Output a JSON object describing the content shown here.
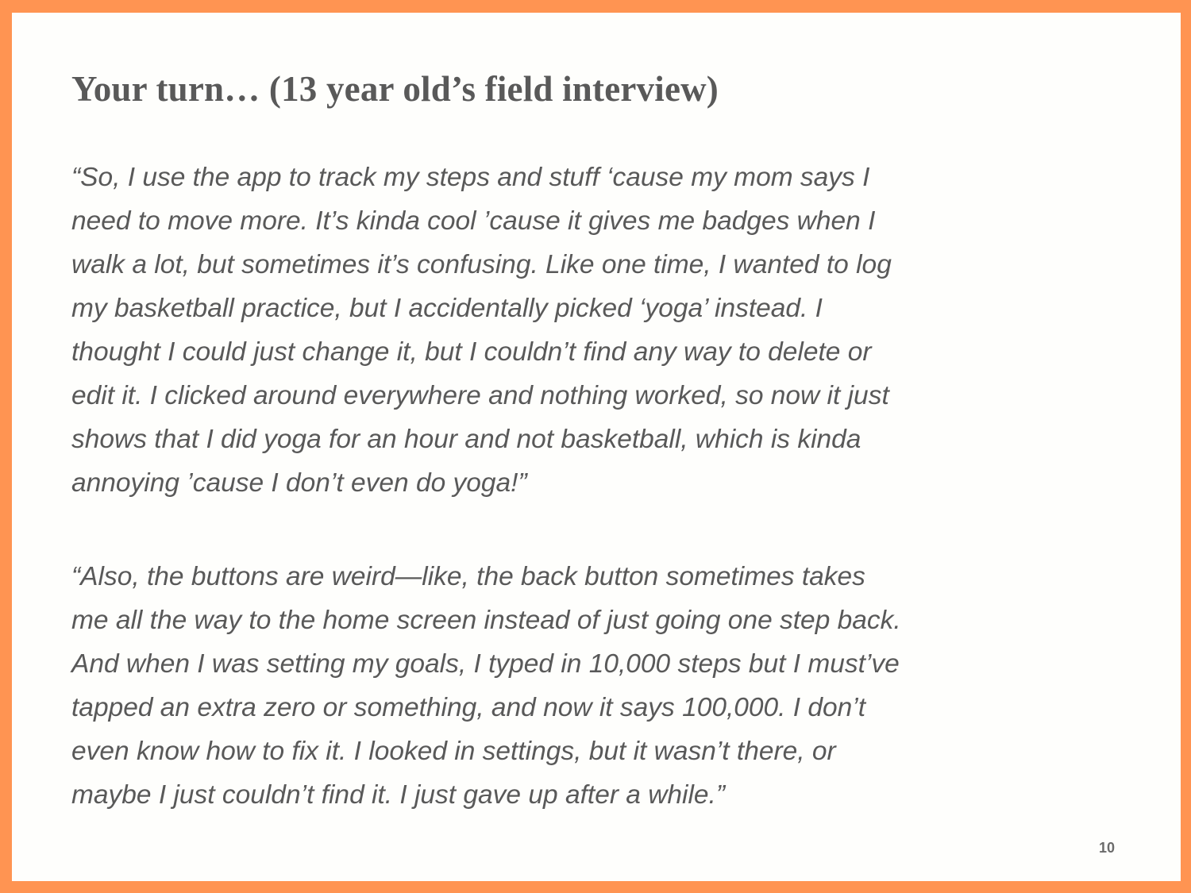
{
  "slide": {
    "title": "Your turn… (13 year old’s field interview)",
    "paragraphs": [
      {
        "lines": [
          "“So, I use the app to track my steps and stuff ‘cause my mom says I",
          "need to move more. It’s kinda cool ’cause it gives me badges when I",
          "walk a lot, but sometimes it’s confusing. Like one time, I wanted to log",
          "my basketball practice, but I accidentally picked ‘yoga’ instead. I",
          "thought I could just change it, but I couldn’t find any way to delete or",
          "edit it. I clicked around everywhere and nothing worked, so now it just",
          "shows that I did yoga for an hour and not basketball, which is kinda",
          "annoying ’cause I don’t even do yoga!”"
        ]
      },
      {
        "lines": [
          "“Also, the buttons are weird—like, the back button sometimes takes",
          "me all the way to the home screen instead of just going one step back.",
          "And when I was setting my goals, I typed in 10,000 steps but I must’ve",
          "tapped an extra zero or something, and now it says 100,000. I don’t",
          "even know how to fix it. I looked in settings, but it wasn’t there, or",
          "maybe I just couldn’t find it. I just gave up after a while.”"
        ]
      }
    ],
    "page_number": "10",
    "colors": {
      "border": "#FF9452",
      "text": "#595959",
      "background": "#FEFEFC"
    }
  }
}
